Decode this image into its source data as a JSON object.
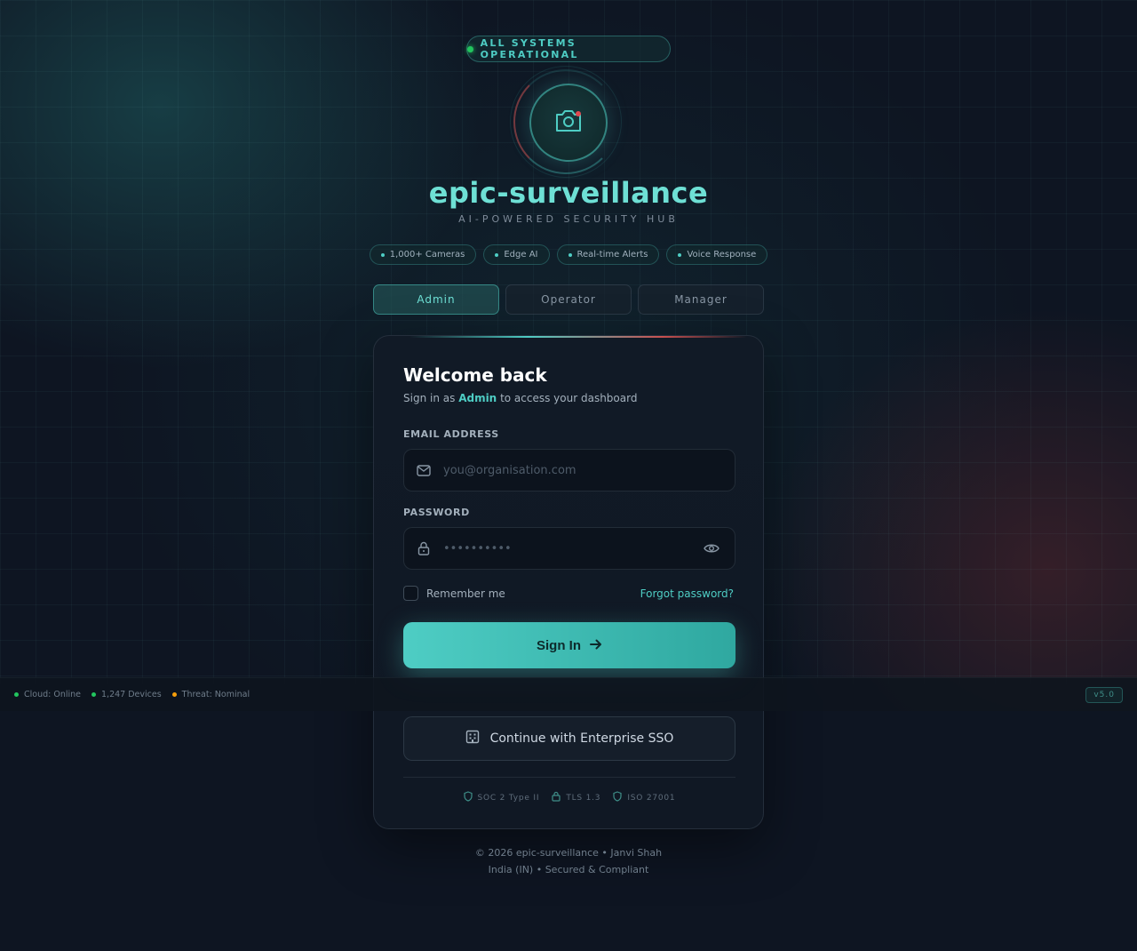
{
  "status": {
    "text": "ALL SYSTEMS OPERATIONAL",
    "color": "#22c55e"
  },
  "brand": {
    "title": "epic-surveillance",
    "subtitle": "AI-POWERED SECURITY HUB",
    "accent": "#4ecdc4",
    "logo_icon": "camera-icon"
  },
  "features": [
    "1,000+ Cameras",
    "Edge AI",
    "Real-time Alerts",
    "Voice Response"
  ],
  "roles": {
    "selected": "Admin",
    "items": [
      "Admin",
      "Operator",
      "Manager"
    ]
  },
  "login": {
    "title": "Welcome back",
    "subtitle_prefix": "Sign in as",
    "subtitle_role": "Admin",
    "subtitle_suffix": "to access your dashboard",
    "email": {
      "label": "EMAIL ADDRESS",
      "placeholder": "you@organisation.com",
      "value": "",
      "icon": "mail-icon"
    },
    "password": {
      "label": "PASSWORD",
      "placeholder": "••••••••••",
      "value": "",
      "icon": "lock-icon",
      "toggle_icon": "eye-icon"
    },
    "remember_label": "Remember me",
    "remember_checked": false,
    "forgot_label": "Forgot password?",
    "signin_label": "Sign In",
    "sso_label": "Continue with Enterprise SSO",
    "compliance": [
      "SOC 2 Type II",
      "TLS 1.3",
      "ISO 27001"
    ]
  },
  "statusbar": {
    "items": [
      {
        "label": "Cloud: Online",
        "color": "#22c55e"
      },
      {
        "label": "1,247 Devices",
        "color": "#22c55e"
      },
      {
        "label": "Threat: Nominal",
        "color": "#f59e0b"
      }
    ],
    "version": "v5.0"
  },
  "footer": {
    "line1": "© 2026 epic-surveillance • Janvi Shah",
    "line2": "India (IN) • Secured & Compliant"
  }
}
